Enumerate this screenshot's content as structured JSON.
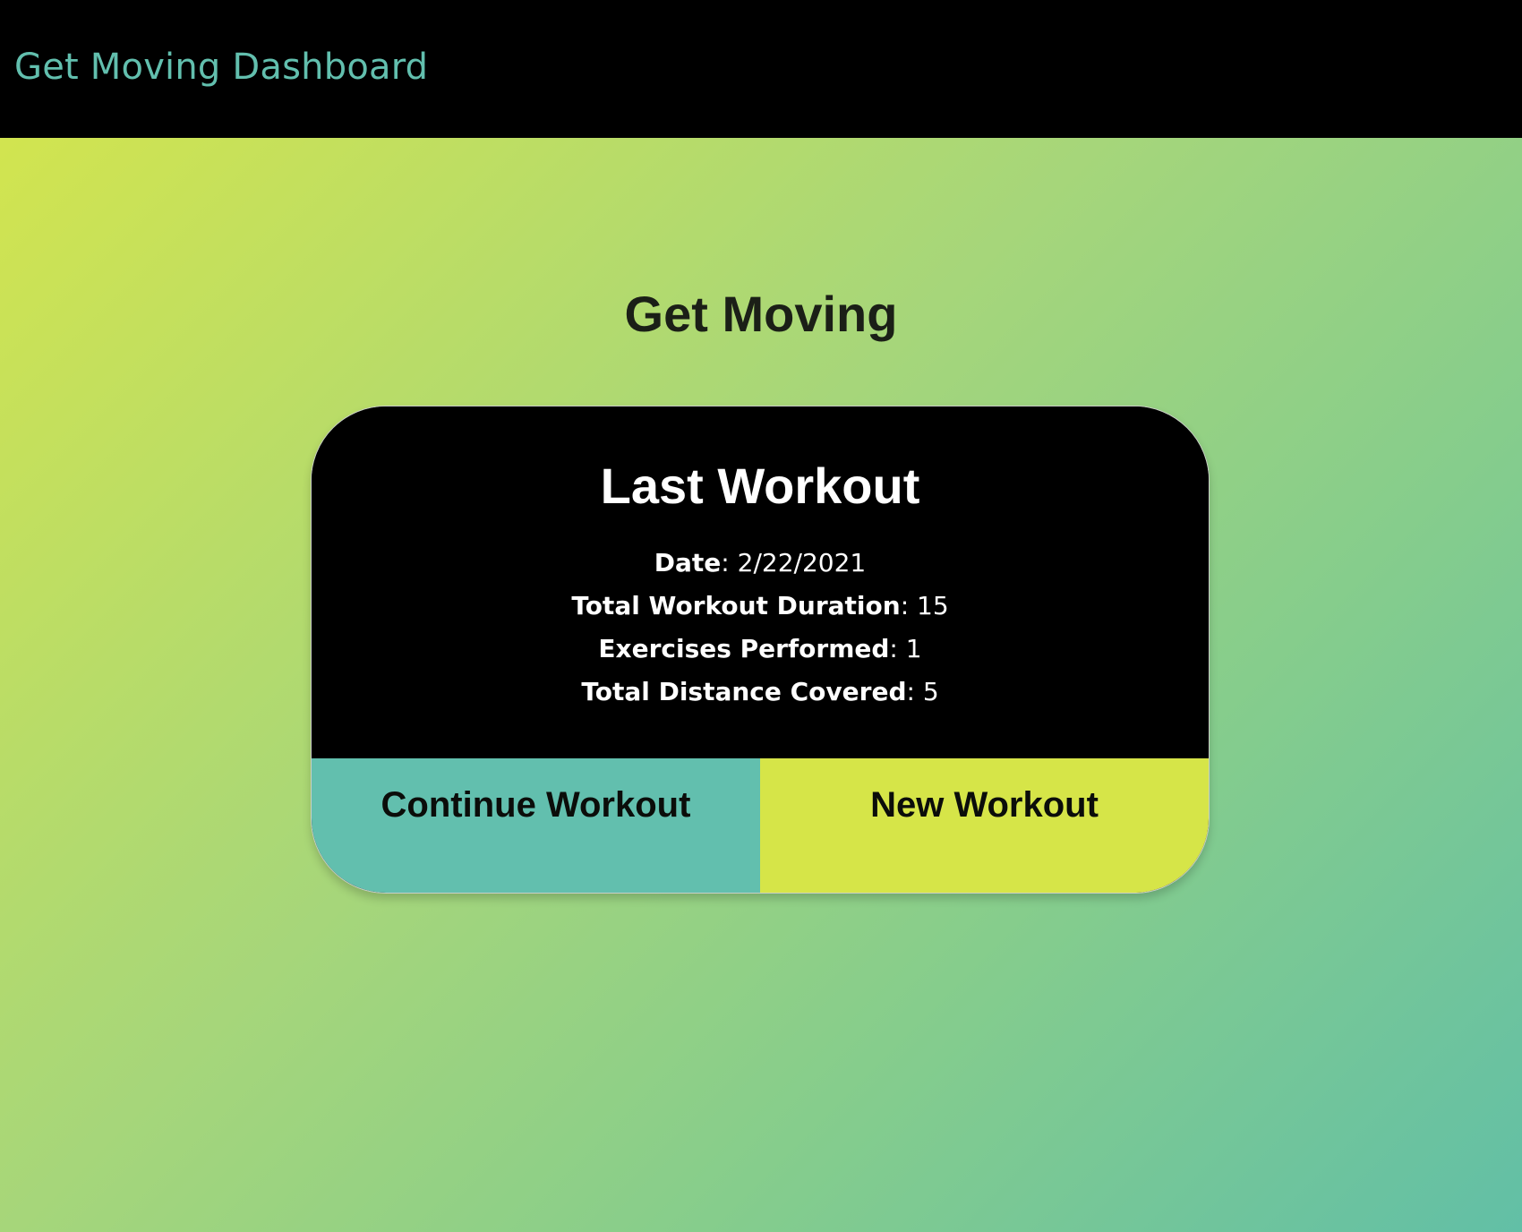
{
  "header": {
    "brand": "Get Moving Dashboard"
  },
  "main": {
    "title": "Get Moving"
  },
  "card": {
    "title": "Last Workout",
    "stats": [
      {
        "label": "Date",
        "value": ": 2/22/2021"
      },
      {
        "label": "Total Workout Duration",
        "value": ": 15"
      },
      {
        "label": "Exercises Performed",
        "value": ": 1"
      },
      {
        "label": "Total Distance Covered",
        "value": ": 5"
      }
    ],
    "buttons": {
      "continue_label": "Continue Workout",
      "new_label": "New Workout"
    }
  },
  "colors": {
    "brand_text": "#62bfae",
    "continue_button": "#62bfae",
    "new_button": "#d6e548",
    "header_bg": "#000000",
    "card_bg": "#000000"
  }
}
